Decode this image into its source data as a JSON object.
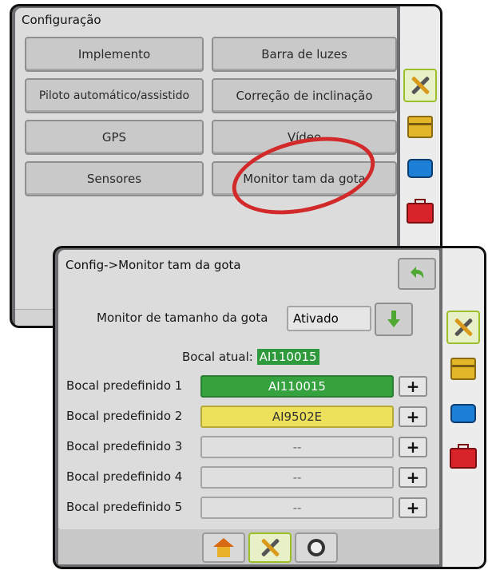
{
  "back_screen": {
    "title": "Configuração",
    "buttons": [
      "Implemento",
      "Barra de luzes",
      "Piloto automático/assistido",
      "Correção de inclinação",
      "GPS",
      "Vídeo",
      "Sensores",
      "Monitor tam da gota"
    ],
    "side_icons": [
      "tools-icon",
      "chest-icon",
      "monitor-icon",
      "toolbox-icon"
    ],
    "highlight_color": "#d22a2a"
  },
  "front_screen": {
    "title": "Config->Monitor tam da gota",
    "monitor_label": "Monitor de tamanho da gota",
    "monitor_value": "Ativado",
    "current_label": "Bocal atual:",
    "current_value": "AI110015",
    "presets": [
      {
        "label": "Bocal predefinido 1",
        "value": "AI110015",
        "color": "#35a13f"
      },
      {
        "label": "Bocal predefinido 2",
        "value": "AI9502E",
        "color": "#ede05a"
      },
      {
        "label": "Bocal predefinido 3",
        "value": "--",
        "color": "#dfdfdf"
      },
      {
        "label": "Bocal predefinido 4",
        "value": "--",
        "color": "#dfdfdf"
      },
      {
        "label": "Bocal predefinido 5",
        "value": "--",
        "color": "#dfdfdf"
      }
    ],
    "plus_label": "+",
    "footer_tabs": [
      "home-icon",
      "tools-icon",
      "gauge-icon"
    ],
    "side_icons": [
      "tools-icon",
      "chest-icon",
      "monitor-icon",
      "toolbox-icon"
    ]
  }
}
